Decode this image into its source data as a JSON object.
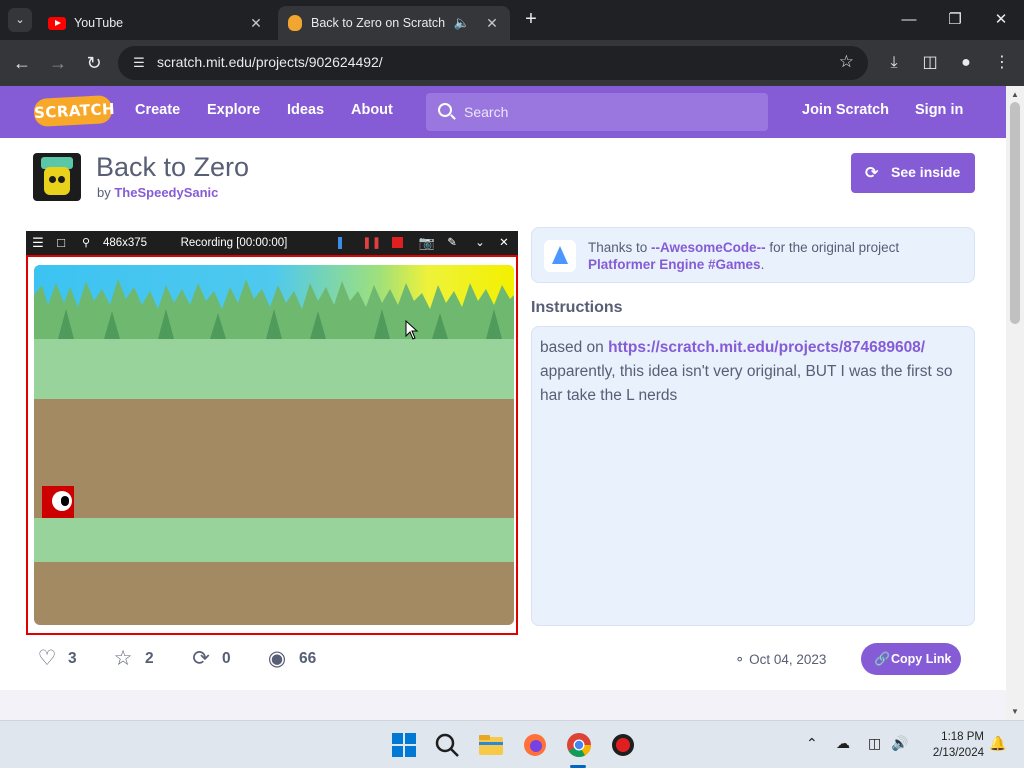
{
  "browser": {
    "tabs": [
      {
        "title": "YouTube"
      },
      {
        "title": "Back to Zero on Scratch"
      }
    ],
    "url": "scratch.mit.edu/projects/902624492/"
  },
  "nav": {
    "logo": "SCRATCH",
    "links": [
      "Create",
      "Explore",
      "Ideas",
      "About"
    ],
    "search_placeholder": "Search",
    "join": "Join Scratch",
    "signin": "Sign in"
  },
  "project": {
    "title": "Back to Zero",
    "by": "by",
    "author": "TheSpeedySanic",
    "see_inside": "See inside"
  },
  "recorder": {
    "size": "486x375",
    "status": "Recording [00:00:00]"
  },
  "credits": {
    "prefix": "Thanks to",
    "user": "--AwesomeCode--",
    "middle": "for the original project",
    "project": "Platformer Engine #Games",
    "suffix": "."
  },
  "instructions": {
    "heading": "Instructions",
    "prefix": "based on",
    "link": "https://scratch.mit.edu/projects/874689608/",
    "body": "apparently, this idea isn't very original, BUT I was the first so har take the L nerds"
  },
  "stats": {
    "loves": "3",
    "favorites": "2",
    "remixes": "0",
    "views": "66"
  },
  "date": "Oct 04, 2023",
  "copy_link": "Copy Link",
  "taskbar": {
    "time": "1:18 PM",
    "date": "2/13/2024"
  },
  "colors": {
    "scratch_purple": "#855cd6",
    "text_gray": "#575e75",
    "record_red": "#e00000",
    "grass": "#97d39a",
    "dirt": "#a38a63"
  }
}
